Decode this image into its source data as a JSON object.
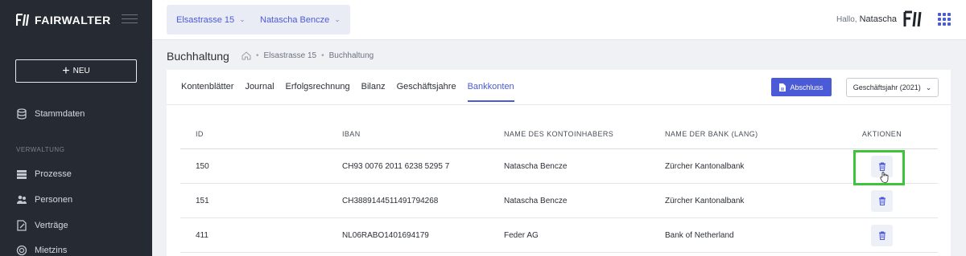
{
  "brand": {
    "name": "FAIRWALTER"
  },
  "sidebar": {
    "new_label": "NEU",
    "stammdaten": "Stammdaten",
    "section": "VERWALTUNG",
    "items": [
      {
        "label": "Prozesse",
        "icon": "layers-icon"
      },
      {
        "label": "Personen",
        "icon": "people-icon"
      },
      {
        "label": "Verträge",
        "icon": "contract-icon"
      },
      {
        "label": "Mietzins",
        "icon": "coins-icon"
      }
    ]
  },
  "topbar": {
    "property": "Elsastrasse 15",
    "person": "Natascha Bencze",
    "greeting": "Hallo,",
    "user": "Natascha"
  },
  "breadcrumb": {
    "title": "Buchhaltung",
    "path": [
      "Elsastrasse 15",
      "Buchhaltung"
    ]
  },
  "tabs": [
    "Kontenblätter",
    "Journal",
    "Erfolgsrechnung",
    "Bilanz",
    "Geschäftsjahre",
    "Bankkonten"
  ],
  "active_tab": "Bankkonten",
  "actions": {
    "close_label": "Abschluss",
    "year_label": "Geschäftsjahr (2021)"
  },
  "table": {
    "headers": [
      "ID",
      "IBAN",
      "NAME DES KONTOINHABERS",
      "NAME DER BANK (LANG)",
      "AKTIONEN"
    ],
    "rows": [
      {
        "id": "150",
        "iban": "CH93 0076 2011 6238 5295 7",
        "owner": "Natascha Bencze",
        "bank": "Zürcher Kantonalbank"
      },
      {
        "id": "151",
        "iban": "CH3889144511491794268",
        "owner": "Natascha Bencze",
        "bank": "Zürcher Kantonalbank"
      },
      {
        "id": "411",
        "iban": "NL06RABO1401694179",
        "owner": "Feder AG",
        "bank": "Bank of Netherland"
      }
    ]
  },
  "colors": {
    "accent": "#4b5ad6",
    "sidebar": "#262b33",
    "highlight": "#3ec43a"
  }
}
